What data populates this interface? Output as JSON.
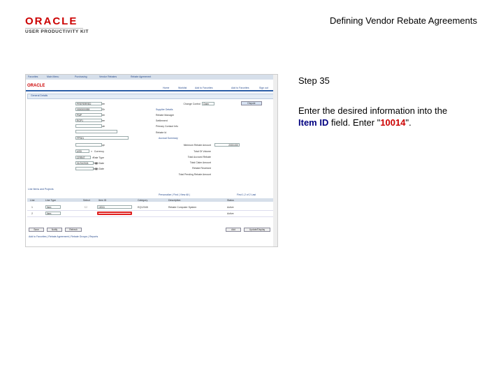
{
  "header": {
    "oracle_logo": "ORACLE",
    "upk_logo": "USER PRODUCTIVITY KIT",
    "doc_title": "Defining Vendor Rebate Agreements"
  },
  "step": {
    "title": "Step 35",
    "instruction_pre": "Enter the desired information into the ",
    "field_name": "Item ID",
    "instruction_mid": " field. Enter \"",
    "value": "10014",
    "instruction_post": "\"."
  },
  "app": {
    "menubar": [
      "Favorites",
      "Main Menu",
      "Purchasing",
      "Vendor Rebates",
      "Rebate Agreement"
    ],
    "brand": "ORACLE",
    "nav": [
      "Home",
      "Worklist",
      "Add to Favorites",
      "Add to Favorites",
      "Sign out"
    ],
    "section_title": "General Details",
    "icons": {
      "lookup": "magnifier-icon",
      "calendar": "calendar-icon"
    },
    "left_labels": [
      "Supplier",
      "Supplier ID",
      "Rebate Manager",
      "Settlement Manager",
      "Primary Contact",
      "Rebate Reference",
      "Location",
      "Rebate Group",
      "Currency",
      "Rate Type",
      "Start Date",
      "Expiration Date"
    ],
    "left_values": [
      "PREFERRED",
      "0000000055",
      "PMP",
      "RGP1",
      "",
      "",
      "FPS01",
      "",
      "USD",
      "CRRNT",
      "01/01/2024",
      ""
    ],
    "right_labels": [
      "Supplier Details",
      "Rebate Manager",
      "Settlement",
      "Primary Contact Info",
      "Rebate Id",
      "Accrual Summary",
      "Minimum Rebate Amount",
      "Total Of Volume",
      "Total Accrued Rebate",
      "Total Claim Amount",
      "Rebate Received",
      "Total Pending Rebate Amount"
    ],
    "status_label": "Change Control",
    "status_value": "Open",
    "dispute_button": "Dispute",
    "min_rebate_value": "2000.000",
    "grid": {
      "title": "Line Items and Projects",
      "toolbar": "Personalize | Find | View All |",
      "pager": "First 1-2 of 2 Last",
      "headers": [
        "Line",
        "Line Type",
        "Select",
        "Item ID",
        "Category",
        "Description",
        "Status"
      ],
      "rows": [
        {
          "line": "1",
          "type": "Item",
          "item": "10011",
          "category": "EQ12345",
          "desc": "Rebate Computer System",
          "status": "Active"
        },
        {
          "line": "2",
          "type": "Item",
          "item": "",
          "category": "",
          "desc": "",
          "status": "Active"
        }
      ]
    },
    "buttons": {
      "save": "Save",
      "notify": "Notify",
      "refresh": "Refresh",
      "add": "Add",
      "update_display": "Update/Display"
    },
    "footer_link": "Add to Favorites | Rebate Agreement | Rebate Groups | Reports"
  }
}
